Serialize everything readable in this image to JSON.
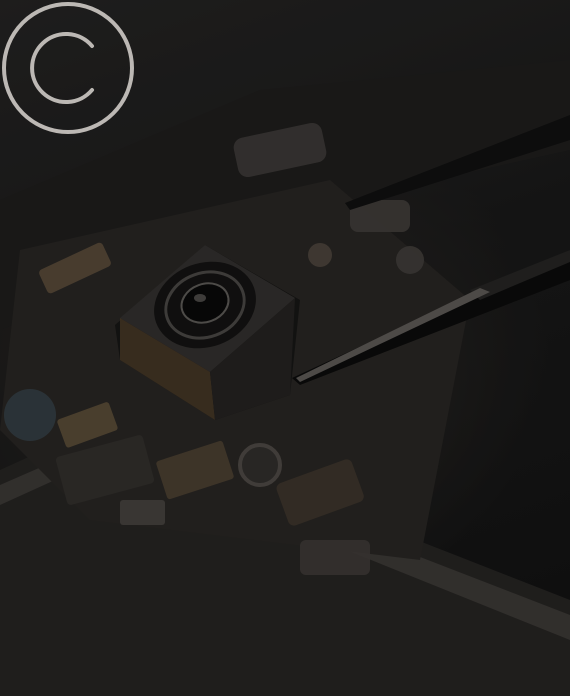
{
  "image": {
    "subject": "smartphone-logic-board-with-camera-module-and-tweezers",
    "tone": "dark-dimmed"
  },
  "watermark": {
    "icon": "copyright-icon",
    "color": "#d8d4cf"
  }
}
